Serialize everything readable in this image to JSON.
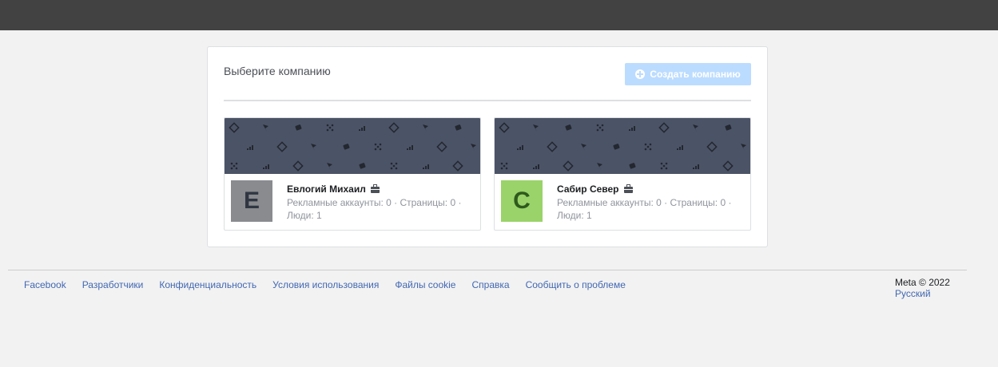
{
  "header": {
    "bar_color": "#424242"
  },
  "panel": {
    "title": "Выберите компанию",
    "create_button": {
      "label": "Создать компанию",
      "icon": "plus-circle-icon",
      "color": "#bcdcff"
    }
  },
  "companies": [
    {
      "initial": "E",
      "name": "Евлогий Михаил",
      "meta": "Рекламные аккаунты: 0 · Страницы: 0 · Люди: 1",
      "avatar_bg": "#8a8b8f",
      "avatar_fg": "#2f3642",
      "icon": "briefcase-icon"
    },
    {
      "initial": "C",
      "name": "Сабир Север",
      "meta": "Рекламные аккаунты: 0 · Страницы: 0 · Люди: 1",
      "avatar_bg": "#9ad36a",
      "avatar_fg": "#2e5a1d",
      "icon": "briefcase-icon"
    }
  ],
  "footer": {
    "links": [
      "Facebook",
      "Разработчики",
      "Конфиденциальность",
      "Условия использования",
      "Файлы cookie",
      "Справка",
      "Сообщить о проблеме"
    ],
    "copyright": "Meta © 2022",
    "language": "Русский"
  }
}
